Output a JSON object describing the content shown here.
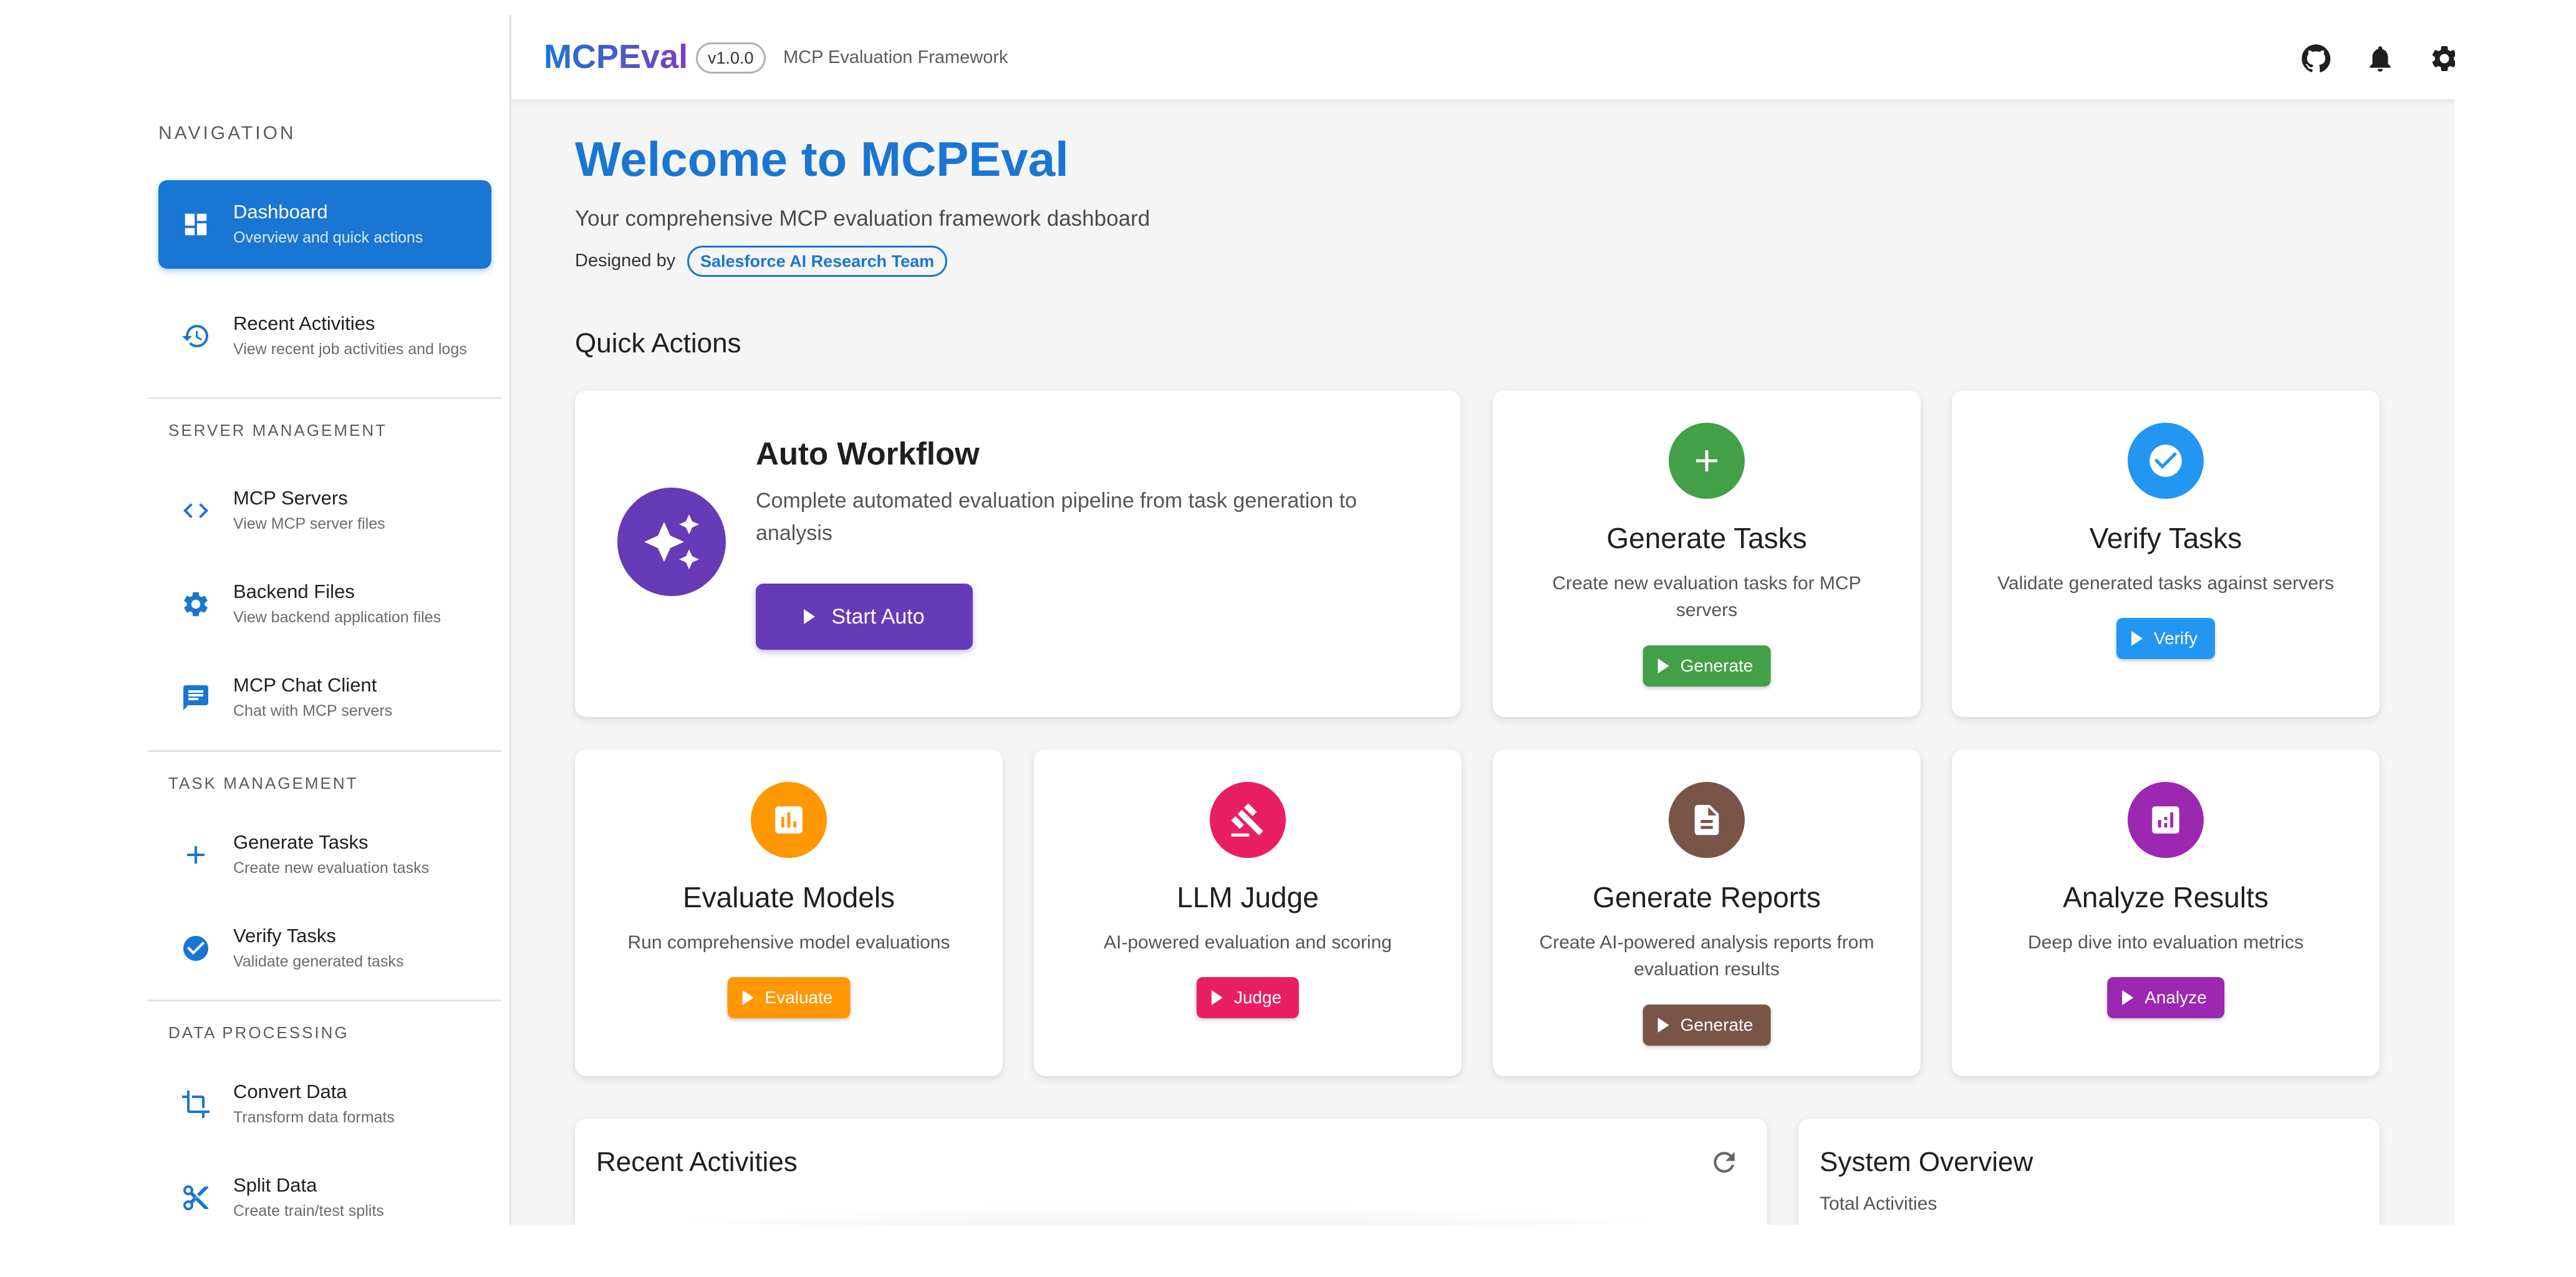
{
  "header": {
    "brand": "MCPEval",
    "version": "v1.0.0",
    "subtitle": "MCP Evaluation Framework",
    "icons": [
      "github-icon",
      "bell-icon",
      "gear-icon",
      "account-icon"
    ]
  },
  "sidebar": {
    "heading": "NAVIGATION",
    "top_items": [
      {
        "title": "Dashboard",
        "subtitle": "Overview and quick actions",
        "icon": "dashboard-icon",
        "active": true
      },
      {
        "title": "Recent Activities",
        "subtitle": "View recent job activities and logs",
        "icon": "history-icon"
      }
    ],
    "sections": [
      {
        "label": "SERVER MANAGEMENT",
        "items": [
          {
            "title": "MCP Servers",
            "subtitle": "View MCP server files",
            "icon": "code-icon"
          },
          {
            "title": "Backend Files",
            "subtitle": "View backend application files",
            "icon": "gear-icon"
          },
          {
            "title": "MCP Chat Client",
            "subtitle": "Chat with MCP servers",
            "icon": "chat-icon"
          }
        ]
      },
      {
        "label": "TASK MANAGEMENT",
        "items": [
          {
            "title": "Generate Tasks",
            "subtitle": "Create new evaluation tasks",
            "icon": "plus-icon"
          },
          {
            "title": "Verify Tasks",
            "subtitle": "Validate generated tasks",
            "icon": "check-circle-icon"
          }
        ]
      },
      {
        "label": "DATA PROCESSING",
        "items": [
          {
            "title": "Convert Data",
            "subtitle": "Transform data formats",
            "icon": "crop-icon"
          },
          {
            "title": "Split Data",
            "subtitle": "Create train/test splits",
            "icon": "scissors-icon"
          }
        ]
      }
    ]
  },
  "main": {
    "welcome_title": "Welcome to MCPEval",
    "welcome_subtitle": "Your comprehensive MCP evaluation framework dashboard",
    "designed_by_label": "Designed by",
    "team": "Salesforce AI Research Team",
    "quick_actions_title": "Quick Actions",
    "auto_workflow": {
      "title": "Auto Workflow",
      "description": "Complete automated evaluation pipeline from task generation to analysis",
      "button": "Start Auto",
      "color": "#673ab7"
    },
    "cards": [
      {
        "title": "Generate Tasks",
        "description": "Create new evaluation tasks for MCP servers",
        "button": "Generate",
        "color": "#43a047",
        "icon": "plus-icon"
      },
      {
        "title": "Verify Tasks",
        "description": "Validate generated tasks against servers",
        "button": "Verify",
        "color": "#2196f3",
        "icon": "check-circle-icon"
      },
      {
        "title": "Evaluate Models",
        "description": "Run comprehensive model evaluations",
        "button": "Evaluate",
        "color": "#ff9800",
        "icon": "assessment-icon"
      },
      {
        "title": "LLM Judge",
        "description": "AI-powered evaluation and scoring",
        "button": "Judge",
        "color": "#e91e63",
        "icon": "gavel-icon"
      },
      {
        "title": "Generate Reports",
        "description": "Create AI-powered analysis reports from evaluation results",
        "button": "Generate",
        "color": "#795548",
        "icon": "document-icon"
      },
      {
        "title": "Analyze Results",
        "description": "Deep dive into evaluation metrics",
        "button": "Analyze",
        "color": "#9c27b0",
        "icon": "analytics-icon"
      }
    ],
    "recent_activities_title": "Recent Activities",
    "system_overview_title": "System Overview",
    "total_activities_label": "Total Activities"
  }
}
